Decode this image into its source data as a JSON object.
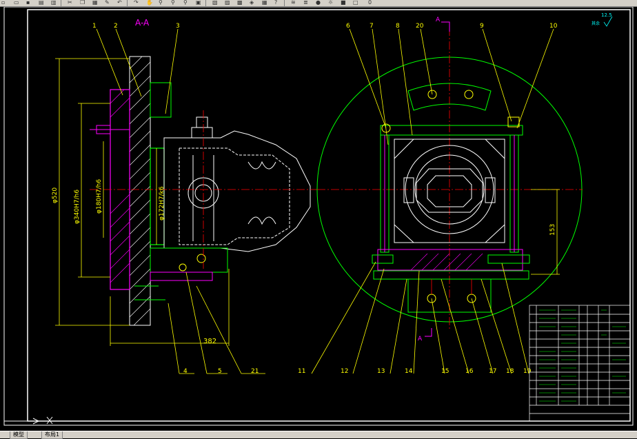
{
  "toolbar": {
    "icons": [
      "new-icon",
      "open-icon",
      "save-icon",
      "print-icon",
      "preview-icon",
      "cut-icon",
      "copy-icon",
      "paste-icon",
      "matchprop-icon",
      "undo-icon",
      "redo-icon",
      "pan-icon",
      "zoom-realtime-icon",
      "zoom-window-icon",
      "zoom-previous-icon",
      "properties-icon",
      "designcenter-icon",
      "toolpalette-icon",
      "sheetset-icon",
      "markup-icon",
      "calc-icon",
      "help-icon",
      "layer-icon",
      "layer-state-icon",
      "bulb-icon",
      "sun-icon",
      "lock-icon",
      "color-icon"
    ],
    "layer_label": "0"
  },
  "drawing": {
    "section_title": "A-A",
    "section_mark_top": "A",
    "section_mark_bottom": "A",
    "roughness": "12.5",
    "roughness_note": "其余",
    "left_balloons": [
      "1",
      "2",
      "3"
    ],
    "bottom_left_balloons": [
      "4",
      "5",
      "21"
    ],
    "right_top_balloons": [
      "6",
      "7",
      "8",
      "20",
      "9",
      "10"
    ],
    "right_bottom_balloons": [
      "11",
      "12",
      "13",
      "14",
      "15",
      "16",
      "17",
      "18",
      "19"
    ],
    "dimensions": {
      "overall_height": "φ520",
      "bore_1": "φ340H7/h6",
      "bore_2": "φ180H7/h6",
      "bore_3": "φ172H7/k6",
      "width": "382",
      "height": "153"
    }
  },
  "tabs": [
    "模型",
    "布局1"
  ],
  "colors": {
    "background": "#000000",
    "yellow": "#ffff00",
    "green": "#00ff00",
    "white": "#ffffff",
    "magenta": "#ff00ff",
    "red": "#ff0000",
    "cyan": "#00ffff"
  }
}
